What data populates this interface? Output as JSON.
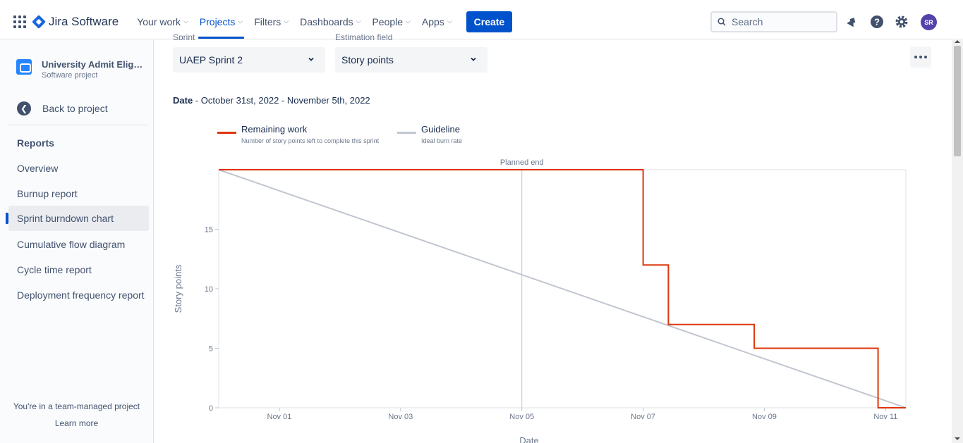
{
  "topbar": {
    "product_name": "Jira Software",
    "nav": [
      {
        "label": "Your work"
      },
      {
        "label": "Projects"
      },
      {
        "label": "Filters"
      },
      {
        "label": "Dashboards"
      },
      {
        "label": "People"
      },
      {
        "label": "Apps"
      }
    ],
    "create_label": "Create",
    "search_placeholder": "Search",
    "avatar_initials": "SR",
    "icons": [
      "app-switcher-icon",
      "notifications-icon",
      "help-icon",
      "settings-icon"
    ]
  },
  "sidebar": {
    "project_name": "University Admit Eligib...",
    "project_type": "Software project",
    "back_label": "Back to project",
    "section_title": "Reports",
    "items": [
      {
        "label": "Overview"
      },
      {
        "label": "Burnup report"
      },
      {
        "label": "Sprint burndown chart"
      },
      {
        "label": "Cumulative flow diagram"
      },
      {
        "label": "Cycle time report"
      },
      {
        "label": "Deployment frequency report"
      }
    ],
    "footer_text": "You're in a team-managed project",
    "footer_link": "Learn more"
  },
  "filters": {
    "sprint_label": "Sprint",
    "sprint_value": "UAEP Sprint 2",
    "estimation_label": "Estimation field",
    "estimation_value": "Story points"
  },
  "date_range": {
    "label": "Date",
    "value": " - October 31st, 2022 - November 5th, 2022"
  },
  "legend": [
    {
      "title": "Remaining work",
      "subtitle": "Number of story points left to complete this sprint",
      "color": "#de350b"
    },
    {
      "title": "Guideline",
      "subtitle": "Ideal burn rate",
      "color": "#c1c7d0"
    }
  ],
  "chart_data": {
    "type": "line",
    "xlabel": "Date",
    "ylabel": "Story points",
    "x_ticks": [
      "Nov 01",
      "Nov 03",
      "Nov 05",
      "Nov 07",
      "Nov 09",
      "Nov 11"
    ],
    "y_ticks": [
      0,
      5,
      10,
      15
    ],
    "ylim": [
      0,
      20
    ],
    "xlim": [
      "2022-10-31",
      "2022-11-11T08:00"
    ],
    "annotation": {
      "label": "Planned end",
      "x": "2022-11-05"
    },
    "series": [
      {
        "name": "Remaining work",
        "color": "#de350b",
        "step": true,
        "points": [
          {
            "x": "2022-10-31",
            "y": 20
          },
          {
            "x": "2022-11-07",
            "y": 20
          },
          {
            "x": "2022-11-07",
            "y": 12
          },
          {
            "x": "2022-11-07T10:00",
            "y": 12
          },
          {
            "x": "2022-11-07T10:00",
            "y": 7
          },
          {
            "x": "2022-11-08T20:00",
            "y": 7
          },
          {
            "x": "2022-11-08T20:00",
            "y": 5
          },
          {
            "x": "2022-11-10T21:00",
            "y": 5
          },
          {
            "x": "2022-11-10T21:00",
            "y": 0
          },
          {
            "x": "2022-11-11T08:00",
            "y": 0
          }
        ]
      },
      {
        "name": "Guideline",
        "color": "#c1c7d0",
        "points": [
          {
            "x": "2022-10-31",
            "y": 20
          },
          {
            "x": "2022-11-11T08:00",
            "y": 0
          }
        ]
      }
    ]
  }
}
